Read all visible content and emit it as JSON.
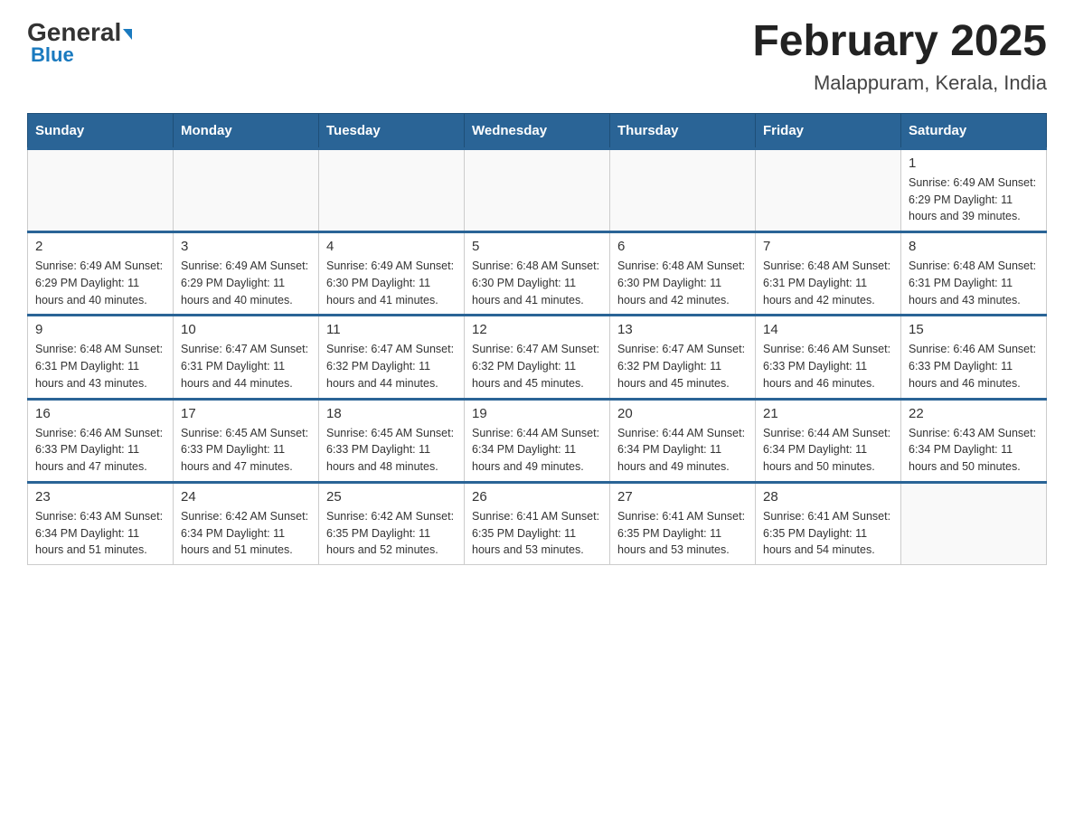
{
  "header": {
    "logo_general": "General",
    "logo_blue": "Blue",
    "title": "February 2025",
    "subtitle": "Malappuram, Kerala, India"
  },
  "days_of_week": [
    "Sunday",
    "Monday",
    "Tuesday",
    "Wednesday",
    "Thursday",
    "Friday",
    "Saturday"
  ],
  "weeks": [
    [
      {
        "day": "",
        "info": ""
      },
      {
        "day": "",
        "info": ""
      },
      {
        "day": "",
        "info": ""
      },
      {
        "day": "",
        "info": ""
      },
      {
        "day": "",
        "info": ""
      },
      {
        "day": "",
        "info": ""
      },
      {
        "day": "1",
        "info": "Sunrise: 6:49 AM\nSunset: 6:29 PM\nDaylight: 11 hours\nand 39 minutes."
      }
    ],
    [
      {
        "day": "2",
        "info": "Sunrise: 6:49 AM\nSunset: 6:29 PM\nDaylight: 11 hours\nand 40 minutes."
      },
      {
        "day": "3",
        "info": "Sunrise: 6:49 AM\nSunset: 6:29 PM\nDaylight: 11 hours\nand 40 minutes."
      },
      {
        "day": "4",
        "info": "Sunrise: 6:49 AM\nSunset: 6:30 PM\nDaylight: 11 hours\nand 41 minutes."
      },
      {
        "day": "5",
        "info": "Sunrise: 6:48 AM\nSunset: 6:30 PM\nDaylight: 11 hours\nand 41 minutes."
      },
      {
        "day": "6",
        "info": "Sunrise: 6:48 AM\nSunset: 6:30 PM\nDaylight: 11 hours\nand 42 minutes."
      },
      {
        "day": "7",
        "info": "Sunrise: 6:48 AM\nSunset: 6:31 PM\nDaylight: 11 hours\nand 42 minutes."
      },
      {
        "day": "8",
        "info": "Sunrise: 6:48 AM\nSunset: 6:31 PM\nDaylight: 11 hours\nand 43 minutes."
      }
    ],
    [
      {
        "day": "9",
        "info": "Sunrise: 6:48 AM\nSunset: 6:31 PM\nDaylight: 11 hours\nand 43 minutes."
      },
      {
        "day": "10",
        "info": "Sunrise: 6:47 AM\nSunset: 6:31 PM\nDaylight: 11 hours\nand 44 minutes."
      },
      {
        "day": "11",
        "info": "Sunrise: 6:47 AM\nSunset: 6:32 PM\nDaylight: 11 hours\nand 44 minutes."
      },
      {
        "day": "12",
        "info": "Sunrise: 6:47 AM\nSunset: 6:32 PM\nDaylight: 11 hours\nand 45 minutes."
      },
      {
        "day": "13",
        "info": "Sunrise: 6:47 AM\nSunset: 6:32 PM\nDaylight: 11 hours\nand 45 minutes."
      },
      {
        "day": "14",
        "info": "Sunrise: 6:46 AM\nSunset: 6:33 PM\nDaylight: 11 hours\nand 46 minutes."
      },
      {
        "day": "15",
        "info": "Sunrise: 6:46 AM\nSunset: 6:33 PM\nDaylight: 11 hours\nand 46 minutes."
      }
    ],
    [
      {
        "day": "16",
        "info": "Sunrise: 6:46 AM\nSunset: 6:33 PM\nDaylight: 11 hours\nand 47 minutes."
      },
      {
        "day": "17",
        "info": "Sunrise: 6:45 AM\nSunset: 6:33 PM\nDaylight: 11 hours\nand 47 minutes."
      },
      {
        "day": "18",
        "info": "Sunrise: 6:45 AM\nSunset: 6:33 PM\nDaylight: 11 hours\nand 48 minutes."
      },
      {
        "day": "19",
        "info": "Sunrise: 6:44 AM\nSunset: 6:34 PM\nDaylight: 11 hours\nand 49 minutes."
      },
      {
        "day": "20",
        "info": "Sunrise: 6:44 AM\nSunset: 6:34 PM\nDaylight: 11 hours\nand 49 minutes."
      },
      {
        "day": "21",
        "info": "Sunrise: 6:44 AM\nSunset: 6:34 PM\nDaylight: 11 hours\nand 50 minutes."
      },
      {
        "day": "22",
        "info": "Sunrise: 6:43 AM\nSunset: 6:34 PM\nDaylight: 11 hours\nand 50 minutes."
      }
    ],
    [
      {
        "day": "23",
        "info": "Sunrise: 6:43 AM\nSunset: 6:34 PM\nDaylight: 11 hours\nand 51 minutes."
      },
      {
        "day": "24",
        "info": "Sunrise: 6:42 AM\nSunset: 6:34 PM\nDaylight: 11 hours\nand 51 minutes."
      },
      {
        "day": "25",
        "info": "Sunrise: 6:42 AM\nSunset: 6:35 PM\nDaylight: 11 hours\nand 52 minutes."
      },
      {
        "day": "26",
        "info": "Sunrise: 6:41 AM\nSunset: 6:35 PM\nDaylight: 11 hours\nand 53 minutes."
      },
      {
        "day": "27",
        "info": "Sunrise: 6:41 AM\nSunset: 6:35 PM\nDaylight: 11 hours\nand 53 minutes."
      },
      {
        "day": "28",
        "info": "Sunrise: 6:41 AM\nSunset: 6:35 PM\nDaylight: 11 hours\nand 54 minutes."
      },
      {
        "day": "",
        "info": ""
      }
    ]
  ]
}
